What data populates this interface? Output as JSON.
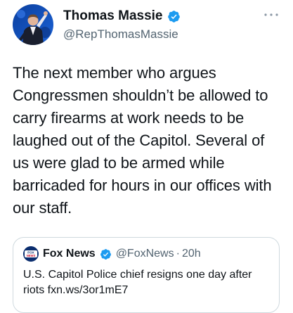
{
  "author": {
    "display_name": "Thomas Massie",
    "handle": "@RepThomasMassie",
    "verified": true,
    "avatar_icon": "user-avatar-photo"
  },
  "more_icon": "more-horizontal-icon",
  "tweet": {
    "lines": [
      "The next member who argues",
      "Congressmen shouldn’t be allowed to",
      "carry firearms at work needs to be",
      "laughed out of the Capitol. Several of",
      "us were glad to be armed while",
      "barricaded for hours in our offices with",
      "our staff."
    ]
  },
  "quote": {
    "logo_text": "FOX NEWS",
    "display_name": "Fox News",
    "verified": true,
    "handle": "@FoxNews",
    "separator": "·",
    "time": "20h",
    "lines": [
      "U.S. Capitol Police chief resigns one day after",
      "riots fxn.ws/3or1mE7"
    ]
  },
  "colors": {
    "verified_blue": "#1d9bf0",
    "secondary_text": "#536471",
    "border": "#cfd9de",
    "fox_blue": "#0a2d6e"
  }
}
